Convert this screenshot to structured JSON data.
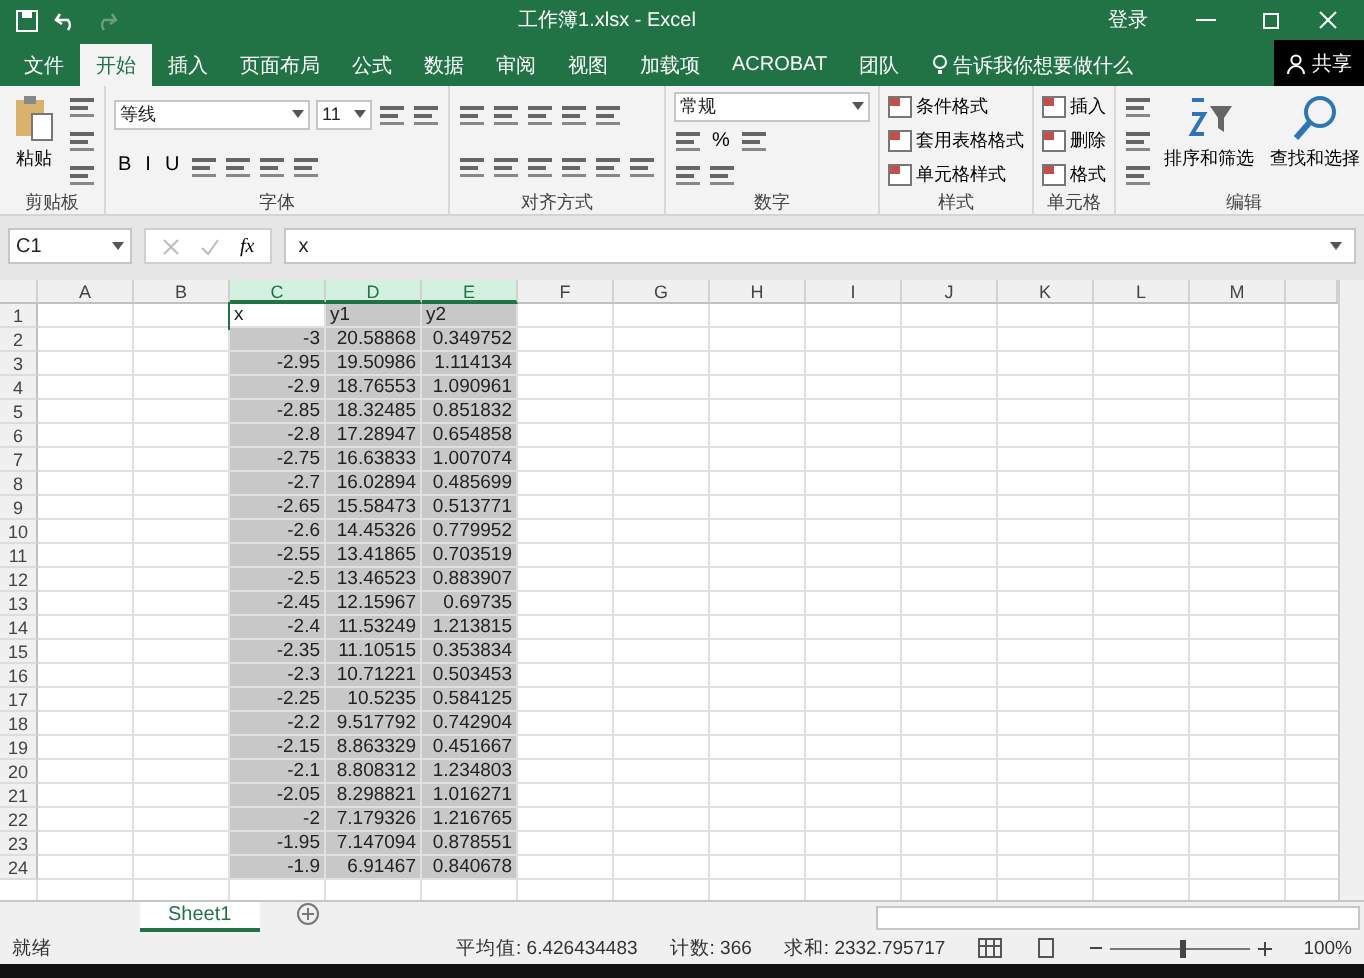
{
  "title_bar": {
    "title": "工作簿1.xlsx  -  Excel",
    "sign_in": "登录"
  },
  "tabs": [
    {
      "label": "文件",
      "selected": false
    },
    {
      "label": "开始",
      "selected": true
    },
    {
      "label": "插入",
      "selected": false
    },
    {
      "label": "页面布局",
      "selected": false
    },
    {
      "label": "公式",
      "selected": false
    },
    {
      "label": "数据",
      "selected": false
    },
    {
      "label": "审阅",
      "selected": false
    },
    {
      "label": "视图",
      "selected": false
    },
    {
      "label": "加载项",
      "selected": false
    },
    {
      "label": "ACROBAT",
      "selected": false
    },
    {
      "label": "团队",
      "selected": false
    }
  ],
  "tell_me": "告诉我你想要做什么",
  "share": "共享",
  "ribbon_groups": [
    {
      "label": "剪贴板",
      "parts": [
        {
          "kind": "clipboard",
          "label": "粘贴"
        },
        {
          "kind": "stack",
          "lines": [
            {
              "items": [
                {
                  "kind": "icon"
                }
              ]
            },
            {
              "items": [
                {
                  "kind": "icon"
                }
              ]
            },
            {
              "items": [
                {
                  "kind": "icon"
                }
              ]
            }
          ]
        }
      ]
    },
    {
      "label": "字体",
      "parts": [
        {
          "kind": "stack",
          "lines": [
            {
              "items": [
                {
                  "kind": "combo",
                  "value": "等线",
                  "wide": true
                },
                {
                  "kind": "combo",
                  "value": "11",
                  "wide": false
                },
                {
                  "kind": "icon"
                },
                {
                  "kind": "icon"
                }
              ]
            },
            {
              "items": [
                {
                  "kind": "text",
                  "label": "B"
                },
                {
                  "kind": "text",
                  "label": "I"
                },
                {
                  "kind": "text",
                  "label": "U"
                },
                {
                  "kind": "icon"
                },
                {
                  "kind": "icon"
                },
                {
                  "kind": "icon"
                },
                {
                  "kind": "icon"
                }
              ]
            }
          ]
        }
      ]
    },
    {
      "label": "对齐方式",
      "parts": [
        {
          "kind": "stack",
          "lines": [
            {
              "items": [
                {
                  "kind": "icon"
                },
                {
                  "kind": "icon"
                },
                {
                  "kind": "icon"
                },
                {
                  "kind": "icon"
                },
                {
                  "kind": "icon"
                }
              ]
            },
            {
              "items": [
                {
                  "kind": "icon"
                },
                {
                  "kind": "icon"
                },
                {
                  "kind": "icon"
                },
                {
                  "kind": "icon"
                },
                {
                  "kind": "icon"
                },
                {
                  "kind": "icon"
                }
              ]
            }
          ]
        }
      ]
    },
    {
      "label": "数字",
      "parts": [
        {
          "kind": "stack",
          "lines": [
            {
              "items": [
                {
                  "kind": "combo",
                  "value": "常规",
                  "wide": true
                }
              ]
            },
            {
              "items": [
                {
                  "kind": "icon"
                },
                {
                  "kind": "text",
                  "label": "%"
                },
                {
                  "kind": "icon"
                }
              ]
            },
            {
              "items": [
                {
                  "kind": "icon"
                },
                {
                  "kind": "icon"
                }
              ]
            }
          ]
        }
      ]
    },
    {
      "label": "样式",
      "parts": [
        {
          "kind": "stack",
          "lines": [
            {
              "items": [
                {
                  "kind": "menu",
                  "label": "条件格式"
                }
              ]
            },
            {
              "items": [
                {
                  "kind": "menu",
                  "label": "套用表格格式"
                }
              ]
            },
            {
              "items": [
                {
                  "kind": "menu",
                  "label": "单元格样式"
                }
              ]
            }
          ]
        }
      ]
    },
    {
      "label": "单元格",
      "parts": [
        {
          "kind": "stack",
          "lines": [
            {
              "items": [
                {
                  "kind": "menu",
                  "label": "插入"
                }
              ]
            },
            {
              "items": [
                {
                  "kind": "menu",
                  "label": "删除"
                }
              ]
            },
            {
              "items": [
                {
                  "kind": "menu",
                  "label": "格式"
                }
              ]
            }
          ]
        }
      ]
    },
    {
      "label": "编辑",
      "parts": [
        {
          "kind": "stack",
          "lines": [
            {
              "items": [
                {
                  "kind": "icon"
                }
              ]
            },
            {
              "items": [
                {
                  "kind": "icon"
                }
              ]
            },
            {
              "items": [
                {
                  "kind": "icon"
                }
              ]
            }
          ]
        },
        {
          "kind": "sort",
          "label": "排序和筛选"
        },
        {
          "kind": "search",
          "label": "查找和选择"
        }
      ]
    }
  ],
  "formula_bar": {
    "name_box": "C1",
    "fx": "fx",
    "value": "x"
  },
  "columns": [
    {
      "label": "A",
      "selected": false
    },
    {
      "label": "B",
      "selected": false
    },
    {
      "label": "C",
      "selected": true
    },
    {
      "label": "D",
      "selected": true
    },
    {
      "label": "E",
      "selected": true
    },
    {
      "label": "F",
      "selected": false
    },
    {
      "label": "G",
      "selected": false
    },
    {
      "label": "H",
      "selected": false
    },
    {
      "label": "I",
      "selected": false
    },
    {
      "label": "J",
      "selected": false
    },
    {
      "label": "K",
      "selected": false
    },
    {
      "label": "L",
      "selected": false
    },
    {
      "label": "M",
      "selected": false
    }
  ],
  "rows": [
    {
      "number": "1",
      "cells": [
        "x",
        "y1",
        "y2"
      ]
    },
    {
      "number": "2",
      "cells": [
        "-3",
        "20.58868",
        "0.349752"
      ]
    },
    {
      "number": "3",
      "cells": [
        "-2.95",
        "19.50986",
        "1.114134"
      ]
    },
    {
      "number": "4",
      "cells": [
        "-2.9",
        "18.76553",
        "1.090961"
      ]
    },
    {
      "number": "5",
      "cells": [
        "-2.85",
        "18.32485",
        "0.851832"
      ]
    },
    {
      "number": "6",
      "cells": [
        "-2.8",
        "17.28947",
        "0.654858"
      ]
    },
    {
      "number": "7",
      "cells": [
        "-2.75",
        "16.63833",
        "1.007074"
      ]
    },
    {
      "number": "8",
      "cells": [
        "-2.7",
        "16.02894",
        "0.485699"
      ]
    },
    {
      "number": "9",
      "cells": [
        "-2.65",
        "15.58473",
        "0.513771"
      ]
    },
    {
      "number": "10",
      "cells": [
        "-2.6",
        "14.45326",
        "0.779952"
      ]
    },
    {
      "number": "11",
      "cells": [
        "-2.55",
        "13.41865",
        "0.703519"
      ]
    },
    {
      "number": "12",
      "cells": [
        "-2.5",
        "13.46523",
        "0.883907"
      ]
    },
    {
      "number": "13",
      "cells": [
        "-2.45",
        "12.15967",
        "0.69735"
      ]
    },
    {
      "number": "14",
      "cells": [
        "-2.4",
        "11.53249",
        "1.213815"
      ]
    },
    {
      "number": "15",
      "cells": [
        "-2.35",
        "11.10515",
        "0.353834"
      ]
    },
    {
      "number": "16",
      "cells": [
        "-2.3",
        "10.71221",
        "0.503453"
      ]
    },
    {
      "number": "17",
      "cells": [
        "-2.25",
        "10.5235",
        "0.584125"
      ]
    },
    {
      "number": "18",
      "cells": [
        "-2.2",
        "9.517792",
        "0.742904"
      ]
    },
    {
      "number": "19",
      "cells": [
        "-2.15",
        "8.863329",
        "0.451667"
      ]
    },
    {
      "number": "20",
      "cells": [
        "-2.1",
        "8.808312",
        "1.234803"
      ]
    },
    {
      "number": "21",
      "cells": [
        "-2.05",
        "8.298821",
        "1.016271"
      ]
    },
    {
      "number": "22",
      "cells": [
        "-2",
        "7.179326",
        "1.216765"
      ]
    },
    {
      "number": "23",
      "cells": [
        "-1.95",
        "7.147094",
        "0.878551"
      ]
    },
    {
      "number": "24",
      "cells": [
        "-1.9",
        "6.91467",
        "0.840678"
      ]
    }
  ],
  "sheet_tabs": [
    {
      "label": "Sheet1",
      "selected": true
    }
  ],
  "status_bar": {
    "ready": "就绪",
    "average": "平均值: 6.426434483",
    "count": "计数: 366",
    "sum": "求和: 2332.795717",
    "zoom": "100%",
    "zoom_level": {
      "level": 0.5
    }
  }
}
